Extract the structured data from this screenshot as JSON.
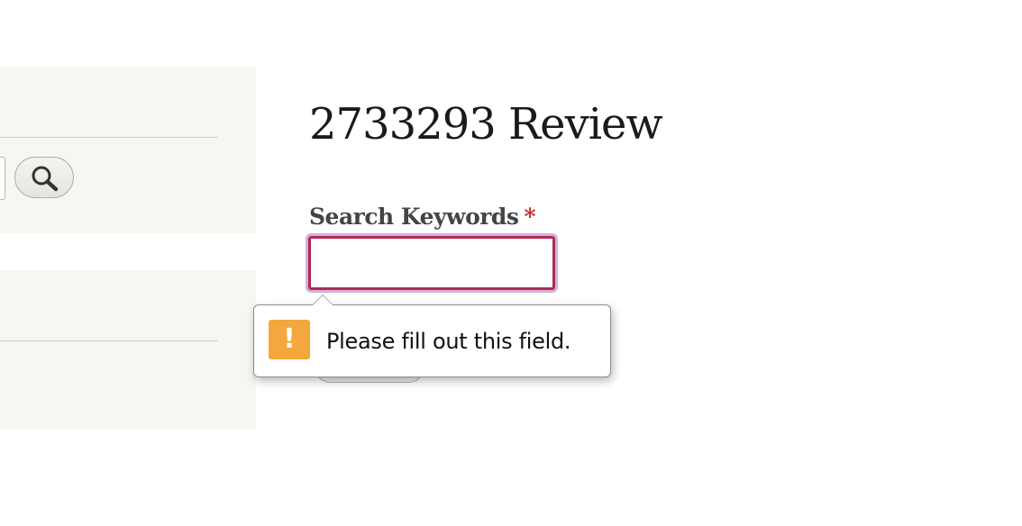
{
  "page": {
    "title": "2733293 Review"
  },
  "form": {
    "keywords_label": "Search Keywords",
    "required_marker": "*",
    "keywords_value": ""
  },
  "validation": {
    "message": "Please fill out this field.",
    "icon": "exclamation-warning-icon",
    "icon_glyph": "!",
    "icon_color": "#f3a73c"
  },
  "sidebar": {
    "search_button_icon": "magnifier-search-icon"
  },
  "colors": {
    "sidebar_bg": "#f6f6f2",
    "invalid_border": "#b02a4e",
    "focus_ring": "#cfb2e0",
    "required": "#cc2a2a"
  }
}
